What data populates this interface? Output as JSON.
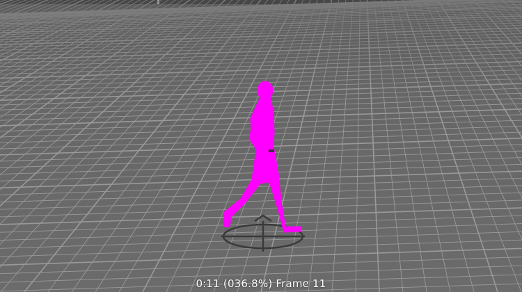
{
  "viewport": {
    "status": "0:11 (036.8%) Frame 11",
    "character_color": "#ff00ff",
    "grid_color": "#9a9a9a",
    "floor_color": "#6a6a6a",
    "playback_progress_percent": 36.8
  },
  "icons": {
    "root_marker": "ground-circle-icon"
  }
}
